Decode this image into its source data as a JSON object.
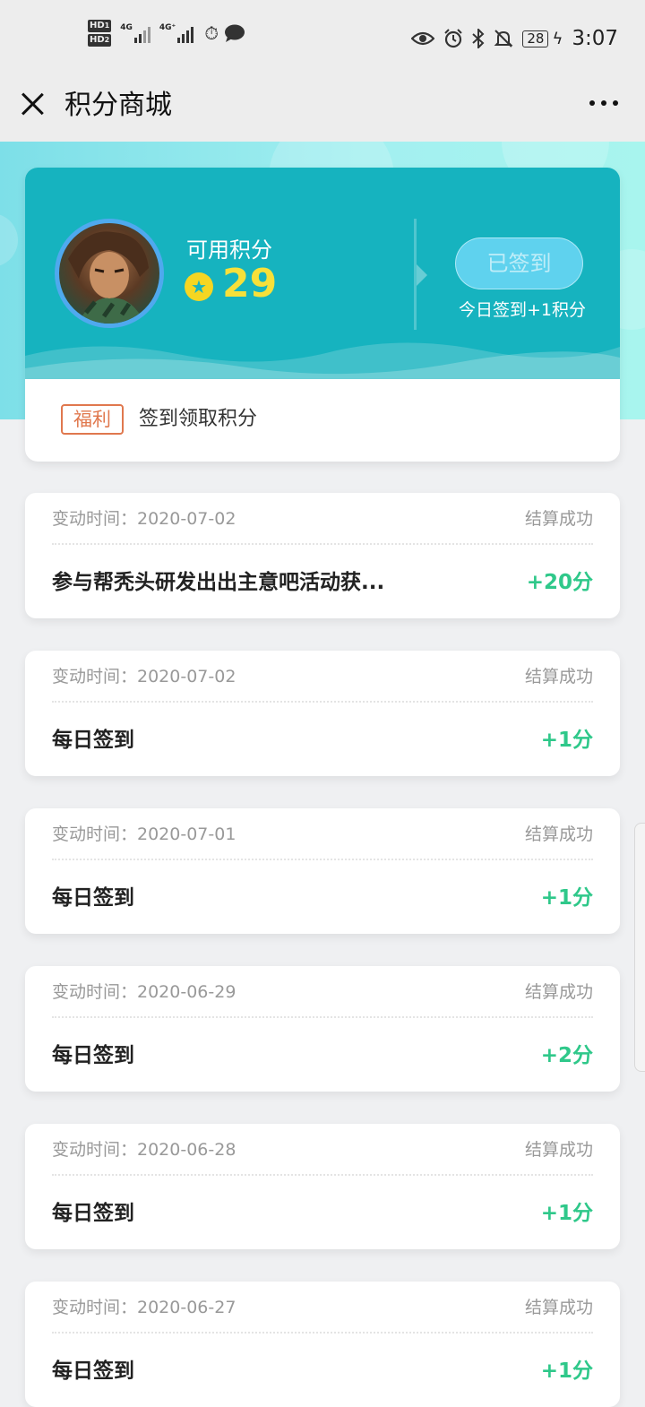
{
  "status_bar": {
    "hd1": "HD",
    "hd1_sub": "1",
    "hd2": "HD",
    "hd2_sub": "2",
    "net1": "4G",
    "net2": "4G⁺",
    "battery": "28",
    "time": "3:07"
  },
  "navbar": {
    "title": "积分商城"
  },
  "user_card": {
    "points_label": "可用积分",
    "points_value": "29",
    "signed_button": "已签到",
    "sign_hint": "今日签到+1积分",
    "welfare_tag": "福利",
    "welfare_text": "签到领取积分",
    "accent_color": "#16b3bf",
    "points_color": "#f7e03a"
  },
  "records": [
    {
      "time": "变动时间：2020-07-02",
      "status": "结算成功",
      "title": "参与帮秃头研发出出主意吧活动获...",
      "points": "+20分"
    },
    {
      "time": "变动时间：2020-07-02",
      "status": "结算成功",
      "title": "每日签到",
      "points": "+1分"
    },
    {
      "time": "变动时间：2020-07-01",
      "status": "结算成功",
      "title": "每日签到",
      "points": "+1分"
    },
    {
      "time": "变动时间：2020-06-29",
      "status": "结算成功",
      "title": "每日签到",
      "points": "+2分"
    },
    {
      "time": "变动时间：2020-06-28",
      "status": "结算成功",
      "title": "每日签到",
      "points": "+1分"
    },
    {
      "time": "变动时间：2020-06-27",
      "status": "结算成功",
      "title": "每日签到",
      "points": "+1分"
    }
  ]
}
